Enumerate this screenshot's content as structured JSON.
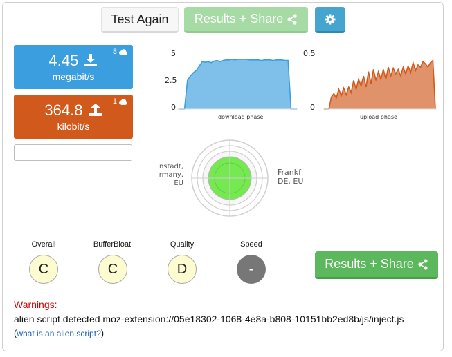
{
  "toolbar": {
    "test_again_label": "Test Again",
    "share_label": "Results + Share",
    "share_icon": "share-icon",
    "settings_icon": "gear-icon"
  },
  "download": {
    "value": "4.45",
    "unit": "megabit/s",
    "streams": "8",
    "icon": "download-icon",
    "color": "#3b9ede"
  },
  "upload": {
    "value": "364.8",
    "unit": "kilobit/s",
    "streams": "1",
    "icon": "upload-icon",
    "color": "#d0591b"
  },
  "chart_data": [
    {
      "type": "area",
      "xlabel": "download phase",
      "ylabel": "",
      "ylim": [
        0,
        5
      ],
      "yticks": [
        "5",
        "2.5",
        "0"
      ],
      "color": "#3b9ede",
      "values": [
        0,
        0,
        0,
        2.6,
        3.0,
        3.3,
        3.5,
        3.9,
        4.3,
        4.25,
        4.3,
        4.2,
        4.35,
        4.4,
        4.3,
        4.4,
        4.45,
        4.45,
        4.5,
        4.45,
        4.5,
        4.5,
        4.5,
        4.5,
        4.45,
        4.45,
        4.45,
        4.45,
        4.4,
        4.45,
        4.45,
        4.45,
        4.4,
        4.45,
        4.45,
        4.45,
        4.4,
        4.4,
        0,
        0,
        0
      ]
    },
    {
      "type": "area",
      "xlabel": "upload phase",
      "ylabel": "",
      "ylim": [
        0,
        0.5
      ],
      "yticks": [
        "0.5",
        "0"
      ],
      "color": "#d0591b",
      "values": [
        0,
        0,
        0,
        0.11,
        0.14,
        0.1,
        0.18,
        0.12,
        0.19,
        0.13,
        0.2,
        0.15,
        0.26,
        0.18,
        0.27,
        0.21,
        0.3,
        0.2,
        0.34,
        0.23,
        0.36,
        0.26,
        0.34,
        0.27,
        0.36,
        0.27,
        0.38,
        0.3,
        0.37,
        0.32,
        0.36,
        0.3,
        0.38,
        0.32,
        0.39,
        0.33,
        0.42,
        0.35,
        0.4,
        0.38,
        0.43,
        0.41,
        0.38,
        0.42,
        0.44,
        0.0
      ]
    }
  ],
  "locations": {
    "left": [
      "nstadt,",
      "rmany,",
      "EU"
    ],
    "right": [
      "Frankf",
      "DE, EU"
    ]
  },
  "grades": [
    {
      "label": "Overall",
      "value": "C",
      "style": "light"
    },
    {
      "label": "BufferBloat",
      "value": "C",
      "style": "light"
    },
    {
      "label": "Quality",
      "value": "D",
      "style": "light"
    },
    {
      "label": "Speed",
      "value": "-",
      "style": "dark"
    }
  ],
  "warnings": {
    "title": "Warnings:",
    "text": "alien script detected moz-extension://05e18302-1068-4e8a-b808-10151bb2ed8b/js/inject.js",
    "link_prefix": "(",
    "link_text": "what is an alien script?",
    "link_suffix": ")"
  },
  "colors": {
    "target_green": "#76e852",
    "share_green": "#5cb85c",
    "settings_blue": "#45a5cf",
    "warning_red": "#d40000"
  }
}
